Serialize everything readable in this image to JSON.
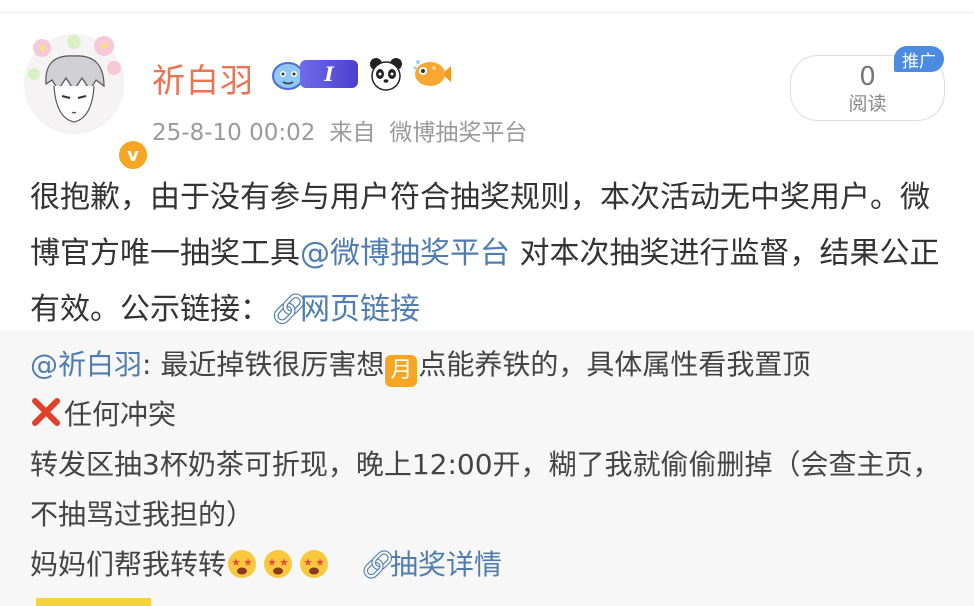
{
  "header": {
    "username": "祈白羽",
    "level_badge": "I",
    "timestamp": "25-8-10 00:02",
    "source_prefix": "来自",
    "source": "微博抽奖平台",
    "verified_mark": "v",
    "read_count": "0",
    "read_label": "阅读",
    "promo_tag": "推广"
  },
  "post": {
    "text_1": "很抱歉，由于没有参与用户符合抽奖规则，本次活动无中奖用户。微博官方唯一抽奖工具",
    "mention": "@微博抽奖平台",
    "text_2": " 对本次抽奖进行监督，结果公正有效。公示链接：",
    "link_label": "网页链接"
  },
  "repost": {
    "author_mention": "@祈白羽",
    "line1_a": ": 最近掉铁很厉害想",
    "month_badge": "月",
    "line1_b": "点能养铁的，具体属性看我置顶",
    "line2": "任何冲突",
    "line3": "转发区抽3杯奶茶可折现，晚上12:00开，糊了我就偷偷删掉（会查主页，不抽骂过我担的）",
    "line4": "妈妈们帮我转转",
    "link_label": "抽奖详情"
  },
  "icons": {
    "link": "link-icon",
    "cross": "cross-mark-icon",
    "face": "star-struck-face-icon"
  },
  "colors": {
    "username": "#eb7350",
    "link": "#507daf",
    "verified": "#f5a623",
    "promo": "#4b8be0"
  }
}
